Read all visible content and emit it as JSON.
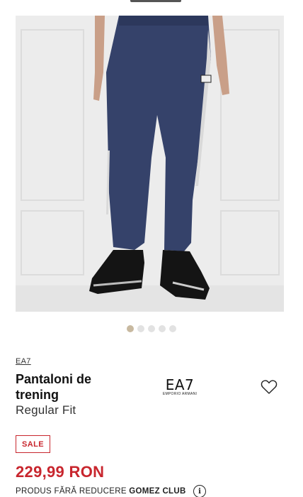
{
  "product": {
    "brand": "EA7",
    "title": "Pantaloni de trening",
    "fit": "Regular Fit",
    "logo_main": "EA7",
    "logo_sub": "EMPORIO ARMANI",
    "sale_label": "SALE",
    "price": "229,99 RON",
    "promo_prefix": "PRODUS FĂRĂ REDUCERE",
    "promo_club": "GOMEZ CLUB",
    "info_glyph": "i"
  },
  "carousel": {
    "total": 5,
    "active_index": 0
  },
  "colors": {
    "sale_red": "#c8262e",
    "dot_active": "#c8b9a0",
    "dot_inactive": "#e2e2e2",
    "pants_navy": "#35426a"
  },
  "icons": {
    "wishlist": "heart-outline-icon",
    "info": "info-circle-icon"
  }
}
